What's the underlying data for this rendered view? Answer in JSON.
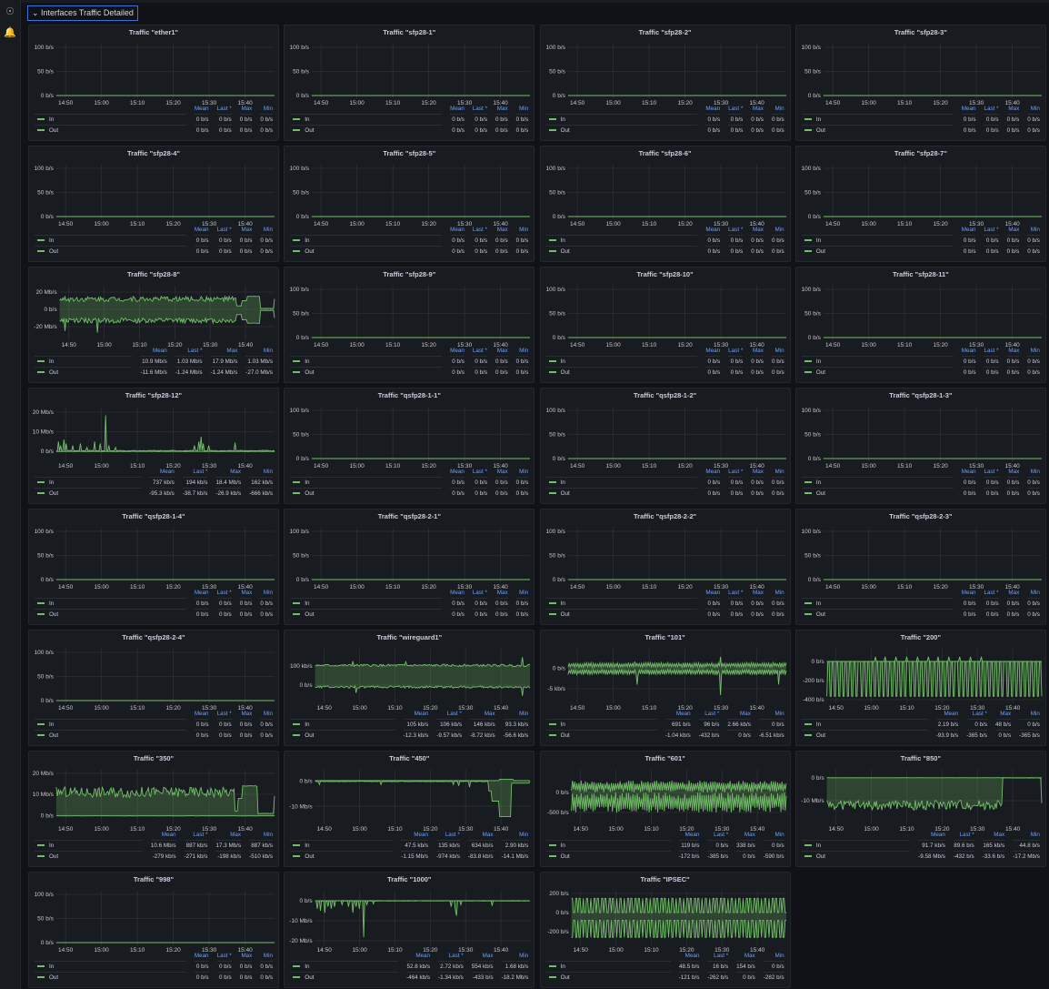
{
  "sidebar": {
    "icons": [
      "explore-icon",
      "alert-bell-icon"
    ]
  },
  "row_title": "Interfaces Traffic Detailed",
  "legend_headers": [
    "Mean",
    "Last *",
    "Max",
    "Min"
  ],
  "series_names": {
    "in": "In",
    "out": "Out"
  },
  "colors": {
    "series": "#73bf69",
    "accent": "#6e9fff",
    "panel": "#181b1f",
    "background": "#111217"
  },
  "time_axis": {
    "range_min": [
      -2.6,
      58.2
    ],
    "ticks": [
      {
        "v": 0,
        "l": "14:50"
      },
      {
        "v": 10,
        "l": "15:00"
      },
      {
        "v": 20,
        "l": "15:10"
      },
      {
        "v": 30,
        "l": "15:20"
      },
      {
        "v": 40,
        "l": "15:30"
      },
      {
        "v": 50,
        "l": "15:40"
      }
    ]
  },
  "default_y_axis": {
    "ylim": [
      -5.7,
      107.5
    ],
    "ticks": [
      {
        "v": 100,
        "l": "100 b/s"
      },
      {
        "v": 50,
        "l": "50 b/s"
      },
      {
        "v": 0,
        "l": "0 b/s"
      }
    ]
  },
  "zero_legend": [
    "0 b/s",
    "0 b/s",
    "0 b/s",
    "0 b/s"
  ],
  "panels": [
    {
      "title": "Traffic \"ether1\""
    },
    {
      "title": "Traffic \"sfp28-1\""
    },
    {
      "title": "Traffic \"sfp28-2\""
    },
    {
      "title": "Traffic \"sfp28-3\""
    },
    {
      "title": "Traffic \"sfp28-4\""
    },
    {
      "title": "Traffic \"sfp28-5\""
    },
    {
      "title": "Traffic \"sfp28-6\""
    },
    {
      "title": "Traffic \"sfp28-7\""
    },
    {
      "title": "Traffic \"sfp28-8\"",
      "y_axis": {
        "ylim": [
          -35.8,
          27.4
        ],
        "ticks": [
          {
            "v": 20,
            "l": "20 Mb/s"
          },
          {
            "v": 0,
            "l": "0 b/s"
          },
          {
            "v": -20,
            "l": "-20 Mb/s"
          }
        ]
      },
      "legend": {
        "in": [
          "10.9 Mb/s",
          "1.03 Mb/s",
          "17.9 Mb/s",
          "1.03 Mb/s"
        ],
        "out": [
          "-11.6 Mb/s",
          "-1.24 Mb/s",
          "-1.24 Mb/s",
          "-27.0 Mb/s"
        ]
      },
      "series": {
        "in": {
          "base": 12,
          "noise": 3,
          "segments": [
            [
              47.5,
              49,
              4
            ],
            [
              49,
              50.5,
              10
            ],
            [
              50.5,
              54,
              15
            ],
            [
              54,
              58.2,
              1.03
            ]
          ]
        },
        "out": {
          "base": -13,
          "noise": 3,
          "spikes": [
            [
              -1,
              -25
            ],
            [
              8,
              -27
            ]
          ],
          "segments": [
            [
              47.5,
              49,
              -6
            ],
            [
              49,
              50.5,
              -12
            ],
            [
              50.5,
              54,
              -16
            ],
            [
              54,
              58.2,
              -1.24
            ]
          ]
        }
      }
    },
    {
      "title": "Traffic \"sfp28-9\""
    },
    {
      "title": "Traffic \"sfp28-10\""
    },
    {
      "title": "Traffic \"sfp28-11\""
    },
    {
      "title": "Traffic \"sfp28-12\"",
      "y_axis": {
        "ylim": [
          -5.1,
          22.8
        ],
        "ticks": [
          {
            "v": 20,
            "l": "20 Mb/s"
          },
          {
            "v": 10,
            "l": "10 Mb/s"
          },
          {
            "v": 0,
            "l": "0 b/s"
          }
        ]
      },
      "legend": {
        "in": [
          "737 kb/s",
          "194 kb/s",
          "18.4 Mb/s",
          "162 kb/s"
        ],
        "out": [
          "-95.3 kb/s",
          "-38.7 kb/s",
          "-26.9 kb/s",
          "-666 kb/s"
        ]
      },
      "series": {
        "in": {
          "base": 0.3,
          "noise": 0.2,
          "spikes": [
            [
              -2,
              5
            ],
            [
              -1.3,
              3
            ],
            [
              -0.5,
              6
            ],
            [
              0.3,
              4
            ],
            [
              2,
              3
            ],
            [
              4,
              4
            ],
            [
              6,
              2
            ],
            [
              8,
              5
            ],
            [
              9.5,
              4
            ],
            [
              11.2,
              18.4
            ],
            [
              12,
              3
            ],
            [
              14,
              2
            ],
            [
              36,
              3
            ],
            [
              37,
              5
            ],
            [
              37.6,
              7.5
            ],
            [
              38.3,
              4
            ],
            [
              40,
              3
            ],
            [
              47.3,
              4.5
            ]
          ]
        },
        "out": {
          "base": -0.1,
          "noise": 0.05
        }
      }
    },
    {
      "title": "Traffic \"qsfp28-1-1\""
    },
    {
      "title": "Traffic \"qsfp28-1-2\""
    },
    {
      "title": "Traffic \"qsfp28-1-3\""
    },
    {
      "title": "Traffic \"qsfp28-1-4\""
    },
    {
      "title": "Traffic \"qsfp28-2-1\""
    },
    {
      "title": "Traffic \"qsfp28-2-2\""
    },
    {
      "title": "Traffic \"qsfp28-2-3\""
    },
    {
      "title": "Traffic \"qsfp28-2-4\""
    },
    {
      "title": "Traffic \"wireguard1\"",
      "y_axis": {
        "ylim": [
          -95,
          190
        ],
        "ticks": [
          {
            "v": 100,
            "l": "100 kb/s"
          },
          {
            "v": 0,
            "l": "0 b/s"
          }
        ]
      },
      "legend": {
        "in": [
          "105 kb/s",
          "106 kb/s",
          "146 kb/s",
          "93.3 kb/s"
        ],
        "out": [
          "-12.3 kb/s",
          "-9.57 kb/s",
          "-8.72 kb/s",
          "-56.6 kb/s"
        ]
      },
      "series": {
        "in": {
          "base": 103,
          "noise": 6,
          "spikes": [
            [
              8,
              125
            ],
            [
              23,
              122
            ],
            [
              56,
              146
            ]
          ]
        },
        "out": {
          "base": -10,
          "noise": 6,
          "spikes": [
            [
              9,
              -40
            ],
            [
              56,
              -56
            ]
          ]
        }
      }
    },
    {
      "title": "Traffic \"101\"",
      "y_axis": {
        "ylim": [
          -8.5,
          4.6
        ],
        "ticks": [
          {
            "v": 0,
            "l": "0 b/s"
          },
          {
            "v": -5,
            "l": "-5 kb/s"
          }
        ]
      },
      "legend": {
        "in": [
          "691 b/s",
          "96 b/s",
          "2.66 kb/s",
          "0 b/s"
        ],
        "out": [
          "-1.04 kb/s",
          "-432 b/s",
          "0 b/s",
          "-6.51 kb/s"
        ]
      },
      "series": {
        "in": {
          "base": 0.7,
          "noise": 0.6,
          "osc": true,
          "spikes": [
            [
              40,
              2.66
            ],
            [
              16,
              1.5
            ]
          ]
        },
        "out": {
          "base": -1,
          "noise": 0.7,
          "osc": true,
          "spikes": [
            [
              16.5,
              -4
            ],
            [
              40,
              -6.5
            ],
            [
              56,
              -4
            ]
          ]
        }
      }
    },
    {
      "title": "Traffic \"200\"",
      "y_axis": {
        "ylim": [
          -438,
          133
        ],
        "ticks": [
          {
            "v": 0,
            "l": "0 b/s"
          },
          {
            "v": -200,
            "l": "-200 b/s"
          },
          {
            "v": -400,
            "l": "-400 b/s"
          }
        ]
      },
      "legend": {
        "in": [
          "2.19 b/s",
          "0 b/s",
          "48 b/s",
          "0 b/s"
        ],
        "out": [
          "-93.9 b/s",
          "-365 b/s",
          "0 b/s",
          "-365 b/s"
        ]
      },
      "series": {
        "in": {
          "base": 0,
          "noise": 0,
          "spikes": [
            [
              11,
              48
            ],
            [
              14,
              48
            ],
            [
              17,
              48
            ],
            [
              20,
              48
            ],
            [
              23,
              48
            ],
            [
              26,
              48
            ],
            [
              29,
              48
            ],
            [
              32,
              48
            ],
            [
              35,
              48
            ],
            [
              38,
              48
            ],
            [
              41,
              48
            ]
          ]
        },
        "out": {
          "square": [
            0,
            -365
          ],
          "period": 1.25
        }
      }
    },
    {
      "title": "Traffic \"350\"",
      "y_axis": {
        "ylim": [
          -4.3,
          21.7
        ],
        "ticks": [
          {
            "v": 20,
            "l": "20 Mb/s"
          },
          {
            "v": 10,
            "l": "10 Mb/s"
          },
          {
            "v": 0,
            "l": "0 b/s"
          }
        ]
      },
      "legend": {
        "in": [
          "10.6 Mb/s",
          "887 kb/s",
          "17.3 Mb/s",
          "887 kb/s"
        ],
        "out": [
          "-279 kb/s",
          "-271 kb/s",
          "-198 kb/s",
          "-510 kb/s"
        ]
      },
      "series": {
        "in": {
          "base": 11,
          "noise": 2.5,
          "segments": [
            [
              47.2,
              48,
              2
            ],
            [
              48,
              49.3,
              8
            ],
            [
              49.3,
              53.5,
              14
            ],
            [
              53.5,
              58.2,
              0.9
            ]
          ]
        },
        "out": {
          "base": -0.28,
          "noise": 0.05
        }
      }
    },
    {
      "title": "Traffic \"450\"",
      "y_axis": {
        "ylim": [
          -17.1,
          4.3
        ],
        "ticks": [
          {
            "v": 0,
            "l": "0 b/s"
          },
          {
            "v": -10,
            "l": "-10 Mb/s"
          }
        ]
      },
      "legend": {
        "in": [
          "47.5 kb/s",
          "135 kb/s",
          "634 kb/s",
          "2.90 kb/s"
        ],
        "out": [
          "-1.15 Mb/s",
          "-974 kb/s",
          "-83.8 kb/s",
          "-14.1 Mb/s"
        ]
      },
      "series": {
        "in": {
          "base": 0.05,
          "noise": 0.02,
          "segments": [
            [
              49.5,
              53.5,
              0.6
            ]
          ]
        },
        "out": {
          "base": -0.3,
          "noise": 0.1,
          "spikes": [
            [
              -1.5,
              -1.5
            ],
            [
              16,
              -1.5
            ],
            [
              36.5,
              -1.5
            ],
            [
              38,
              -2
            ],
            [
              41,
              -2.5
            ]
          ],
          "segments": [
            [
              46.5,
              47.5,
              -4
            ],
            [
              47.5,
              49.5,
              -8
            ],
            [
              49.5,
              53,
              -14.1
            ],
            [
              53,
              58.2,
              -0.97
            ]
          ]
        }
      }
    },
    {
      "title": "Traffic \"601\"",
      "y_axis": {
        "ylim": [
          -795,
          568
        ],
        "ticks": [
          {
            "v": 0,
            "l": "0 b/s"
          },
          {
            "v": -500,
            "l": "-500 b/s"
          }
        ]
      },
      "legend": {
        "in": [
          "119 b/s",
          "0 b/s",
          "338 b/s",
          "0 b/s"
        ],
        "out": [
          "-172 b/s",
          "-385 b/s",
          "0 b/s",
          "-590 b/s"
        ]
      },
      "series": {
        "in": {
          "base": 150,
          "noise": 150,
          "osc": true
        },
        "out": {
          "base": -250,
          "noise": 250,
          "osc": true
        }
      }
    },
    {
      "title": "Traffic \"850\"",
      "y_axis": {
        "ylim": [
          -20.4,
          3.6
        ],
        "ticks": [
          {
            "v": 0,
            "l": "0 b/s"
          },
          {
            "v": -10,
            "l": "-10 Mb/s"
          }
        ]
      },
      "legend": {
        "in": [
          "91.7 kb/s",
          "89.6 b/s",
          "165 kb/s",
          "44.8 b/s"
        ],
        "out": [
          "-9.58 Mb/s",
          "-432 b/s",
          "-33.6 b/s",
          "-17.2 Mb/s"
        ]
      },
      "series": {
        "in": {
          "base": 0.09,
          "noise": 0.02
        },
        "out": {
          "base": -12,
          "noise": 2.2,
          "segments": [
            [
              47,
              58.2,
              0
            ]
          ]
        }
      }
    },
    {
      "title": "Traffic \"998\""
    },
    {
      "title": "Traffic \"1000\"",
      "y_axis": {
        "ylim": [
          -22.3,
          5
        ],
        "ticks": [
          {
            "v": 0,
            "l": "0 b/s"
          },
          {
            "v": -10,
            "l": "-10 Mb/s"
          },
          {
            "v": -20,
            "l": "-20 Mb/s"
          }
        ]
      },
      "legend": {
        "in": [
          "52.8 kb/s",
          "2.72 kb/s",
          "554 kb/s",
          "1.68 kb/s"
        ],
        "out": [
          "-464 kb/s",
          "-1.34 kb/s",
          "-433 b/s",
          "-18.2 Mb/s"
        ]
      },
      "series": {
        "in": {
          "base": 0.05,
          "noise": 0.02
        },
        "out": {
          "base": -0.1,
          "noise": 0.05,
          "spikes": [
            [
              -2,
              -4
            ],
            [
              -1,
              -5
            ],
            [
              0,
              -6
            ],
            [
              1,
              -3
            ],
            [
              2,
              -4
            ],
            [
              3,
              -3
            ],
            [
              5,
              -2
            ],
            [
              7,
              -3
            ],
            [
              8,
              -6
            ],
            [
              9,
              -3
            ],
            [
              10,
              -4
            ],
            [
              11.3,
              -18.2
            ],
            [
              12,
              -2
            ],
            [
              14,
              -1.5
            ],
            [
              36,
              -3
            ],
            [
              37,
              -5
            ],
            [
              37.5,
              -7.5
            ],
            [
              38.5,
              -2
            ],
            [
              47.5,
              -2.5
            ]
          ]
        }
      }
    },
    {
      "title": "Traffic \"IPSEC\"",
      "y_axis": {
        "ylim": [
          -343,
          228.6
        ],
        "ticks": [
          {
            "v": 200,
            "l": "200 b/s"
          },
          {
            "v": 0,
            "l": "0 b/s"
          },
          {
            "v": -200,
            "l": "-200 b/s"
          }
        ]
      },
      "legend": {
        "in": [
          "48.5 b/s",
          "16 b/s",
          "154 b/s",
          "0 b/s"
        ],
        "out": [
          "-121 b/s",
          "-262 b/s",
          "0 b/s",
          "-282 b/s"
        ]
      },
      "series": {
        "in": {
          "square": [
            0,
            150
          ],
          "period": 1.05
        },
        "out": {
          "square": [
            -80,
            -260
          ],
          "period": 1.05
        }
      }
    }
  ]
}
